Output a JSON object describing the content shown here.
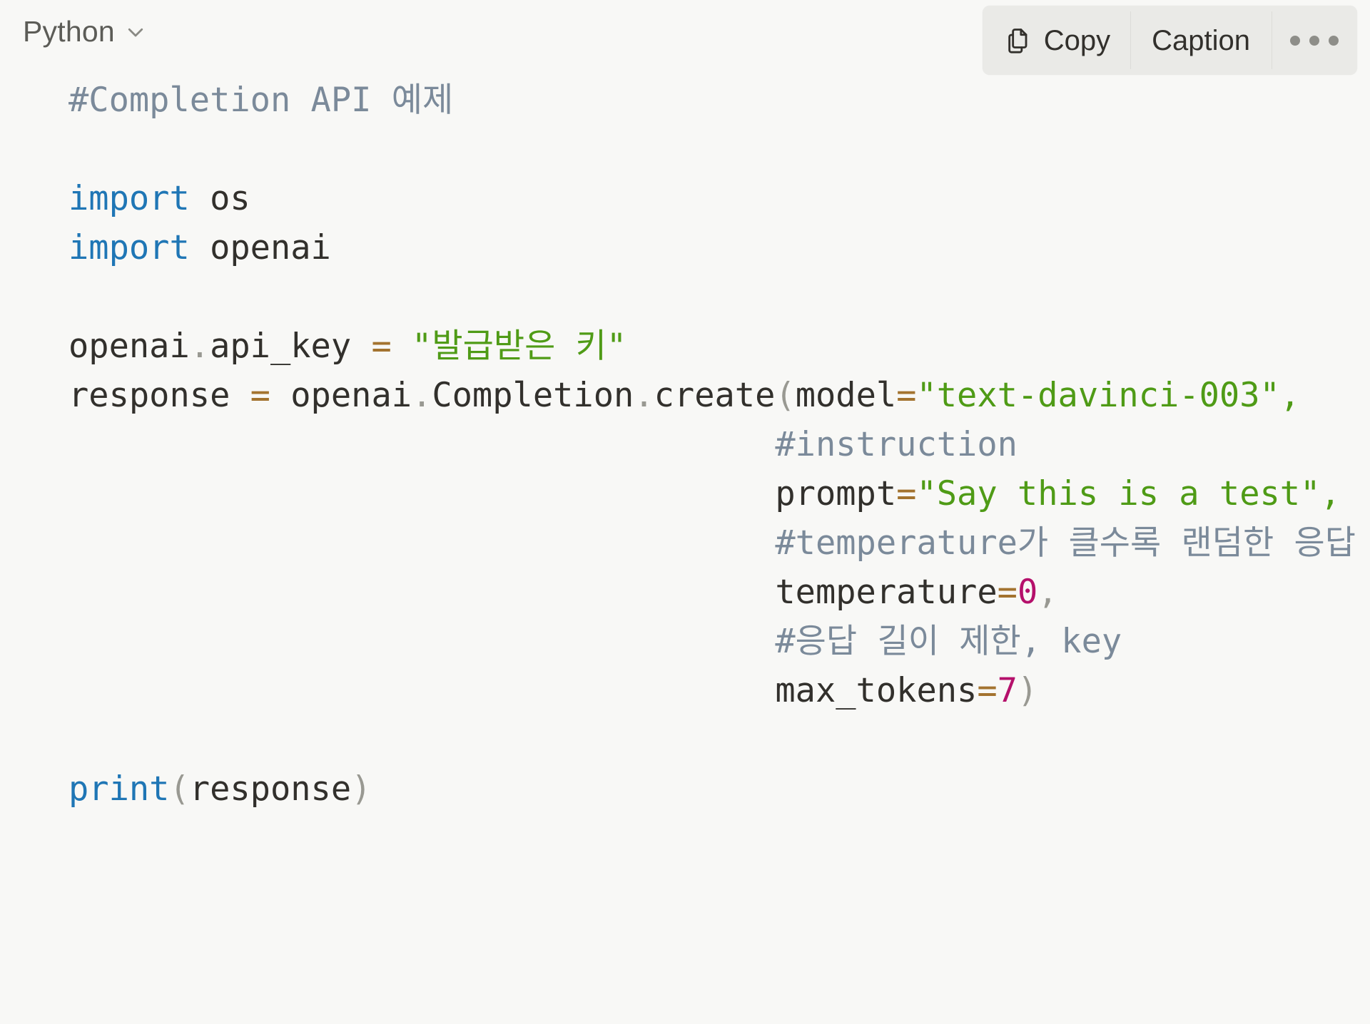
{
  "block": {
    "language_label": "Python",
    "language_chevron_icon": "chevron-down-icon"
  },
  "toolbar": {
    "copy_label": "Copy",
    "copy_icon": "copy-icon",
    "caption_label": "Caption",
    "more_icon": "ellipsis-icon"
  },
  "colors": {
    "page_background": "#f8f8f6",
    "toolbar_background": "#eaeae7",
    "toolbar_divider": "#dcdcd8",
    "comment": "#7b8a9a",
    "keyword": "#1f76b5",
    "string": "#4f9b16",
    "number": "#b5106b",
    "operator": "#a3732f",
    "punctuation": "#999992",
    "plain_text": "#32302c"
  },
  "code": {
    "language": "python",
    "lines": [
      {
        "tokens": [
          {
            "t": "#Completion API 예제",
            "c": "comment"
          }
        ]
      },
      {
        "tokens": []
      },
      {
        "tokens": [
          {
            "t": "import",
            "c": "keyword"
          },
          {
            "t": " os",
            "c": "plain"
          }
        ]
      },
      {
        "tokens": [
          {
            "t": "import",
            "c": "keyword"
          },
          {
            "t": " openai",
            "c": "plain"
          }
        ]
      },
      {
        "tokens": []
      },
      {
        "tokens": [
          {
            "t": "openai",
            "c": "plain"
          },
          {
            "t": ".",
            "c": "punct"
          },
          {
            "t": "api_key ",
            "c": "plain"
          },
          {
            "t": "=",
            "c": "op"
          },
          {
            "t": " ",
            "c": "plain"
          },
          {
            "t": "\"발급받은 키\"",
            "c": "string"
          }
        ]
      },
      {
        "tokens": [
          {
            "t": "response ",
            "c": "plain"
          },
          {
            "t": "=",
            "c": "op"
          },
          {
            "t": " openai",
            "c": "plain"
          },
          {
            "t": ".",
            "c": "punct"
          },
          {
            "t": "Completion",
            "c": "plain"
          },
          {
            "t": ".",
            "c": "punct"
          },
          {
            "t": "create",
            "c": "plain"
          },
          {
            "t": "(",
            "c": "punct"
          },
          {
            "t": "model",
            "c": "plain"
          },
          {
            "t": "=",
            "c": "op"
          },
          {
            "t": "\"text-davinci-003\",",
            "c": "string"
          }
        ]
      },
      {
        "tokens": [
          {
            "t": "                                   ",
            "c": "plain"
          },
          {
            "t": "#instruction",
            "c": "comment"
          }
        ]
      },
      {
        "tokens": [
          {
            "t": "                                   prompt",
            "c": "plain"
          },
          {
            "t": "=",
            "c": "op"
          },
          {
            "t": "\"Say this is a test\",",
            "c": "string"
          }
        ]
      },
      {
        "tokens": [
          {
            "t": "                                   ",
            "c": "plain"
          },
          {
            "t": "#temperature가 클수록 랜덤한 응답",
            "c": "comment"
          }
        ]
      },
      {
        "tokens": [
          {
            "t": "                                   temperature",
            "c": "plain"
          },
          {
            "t": "=",
            "c": "op"
          },
          {
            "t": "0",
            "c": "number"
          },
          {
            "t": ",",
            "c": "punct"
          }
        ]
      },
      {
        "tokens": [
          {
            "t": "                                   ",
            "c": "plain"
          },
          {
            "t": "#응답 길이 제한, key",
            "c": "comment"
          }
        ]
      },
      {
        "tokens": [
          {
            "t": "                                   max_tokens",
            "c": "plain"
          },
          {
            "t": "=",
            "c": "op"
          },
          {
            "t": "7",
            "c": "number"
          },
          {
            "t": ")",
            "c": "punct"
          }
        ]
      },
      {
        "tokens": []
      },
      {
        "tokens": [
          {
            "t": "print",
            "c": "keyword"
          },
          {
            "t": "(",
            "c": "punct"
          },
          {
            "t": "response",
            "c": "plain"
          },
          {
            "t": ")",
            "c": "punct"
          }
        ]
      }
    ]
  }
}
